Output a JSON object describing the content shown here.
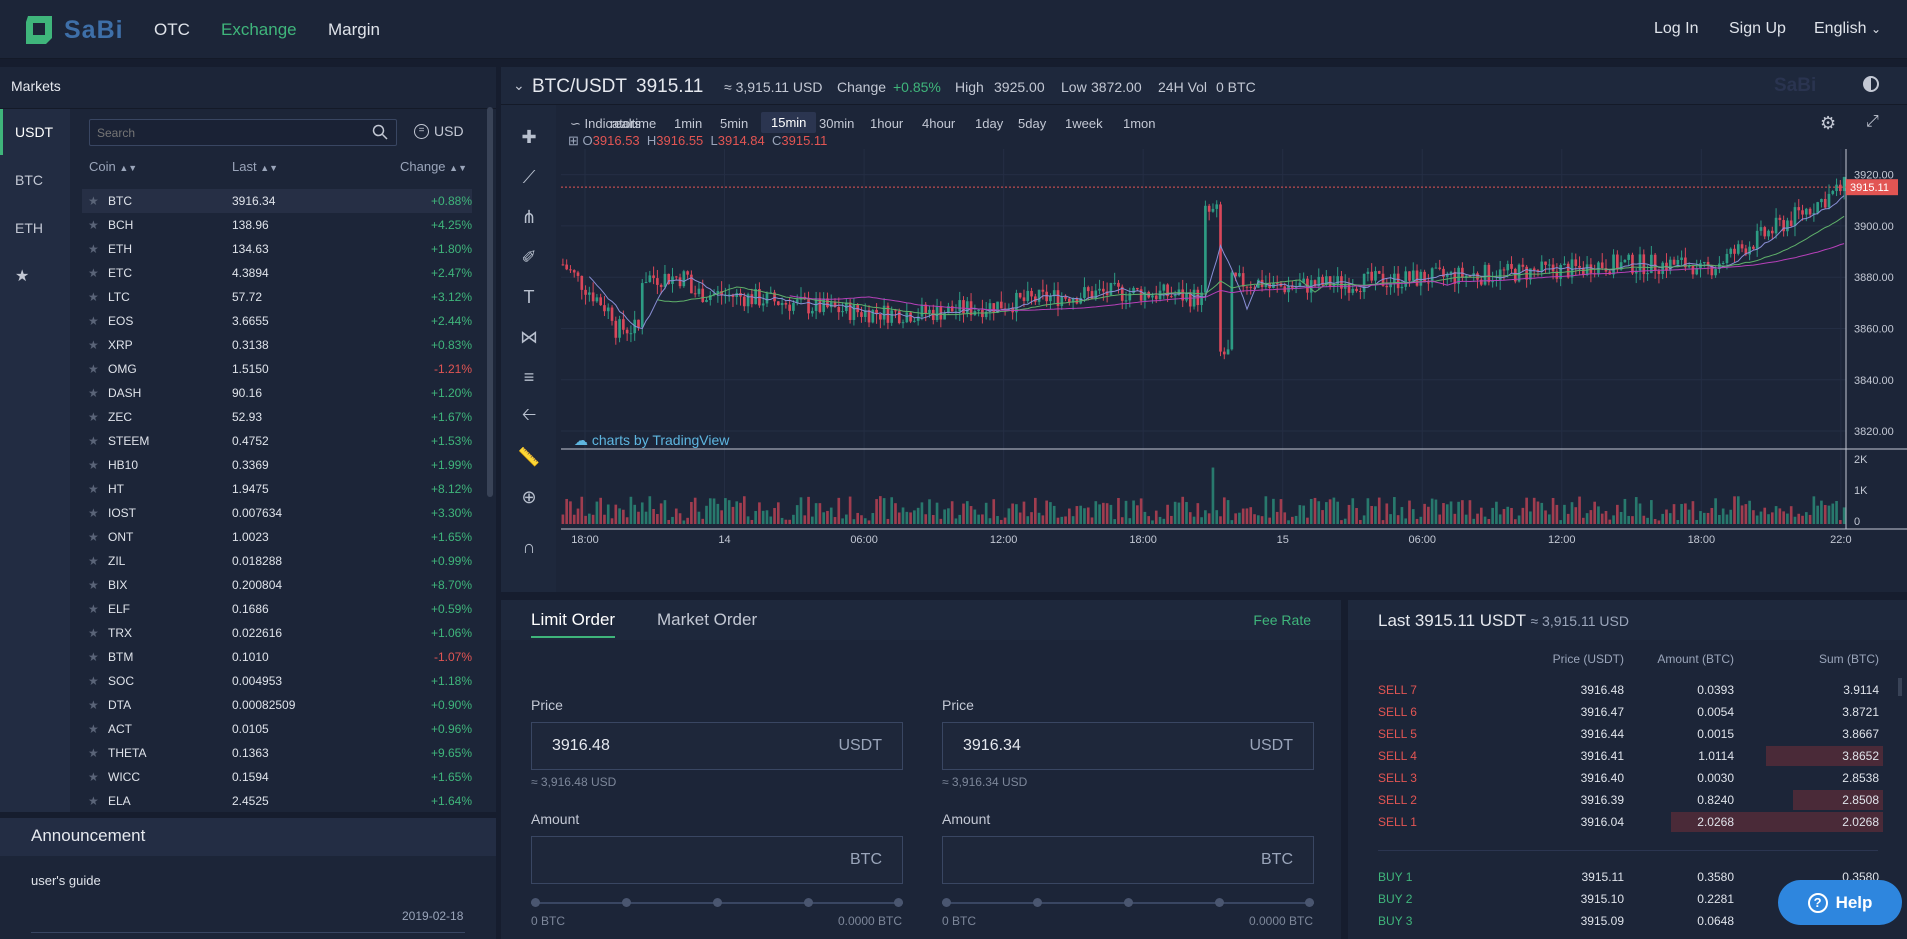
{
  "brand": {
    "name": "SaBi",
    "accent": "#3fb57b"
  },
  "nav": {
    "otc": "OTC",
    "exchange": "Exchange",
    "margin": "Margin"
  },
  "top_right": {
    "login": "Log In",
    "signup": "Sign Up",
    "language": "English"
  },
  "markets": {
    "title": "Markets",
    "quote_tabs": [
      "USDT",
      "BTC",
      "ETH"
    ],
    "favorites_icon": "star-icon",
    "search_placeholder": "Search",
    "currency": "USD",
    "columns": {
      "coin": "Coin",
      "last": "Last",
      "change": "Change"
    },
    "rows": [
      {
        "coin": "BTC",
        "last": "3916.34",
        "change": "+0.88%"
      },
      {
        "coin": "BCH",
        "last": "138.96",
        "change": "+4.25%"
      },
      {
        "coin": "ETH",
        "last": "134.63",
        "change": "+1.80%"
      },
      {
        "coin": "ETC",
        "last": "4.3894",
        "change": "+2.47%"
      },
      {
        "coin": "LTC",
        "last": "57.72",
        "change": "+3.12%"
      },
      {
        "coin": "EOS",
        "last": "3.6655",
        "change": "+2.44%"
      },
      {
        "coin": "XRP",
        "last": "0.3138",
        "change": "+0.83%"
      },
      {
        "coin": "OMG",
        "last": "1.5150",
        "change": "-1.21%"
      },
      {
        "coin": "DASH",
        "last": "90.16",
        "change": "+1.20%"
      },
      {
        "coin": "ZEC",
        "last": "52.93",
        "change": "+1.67%"
      },
      {
        "coin": "STEEM",
        "last": "0.4752",
        "change": "+1.53%"
      },
      {
        "coin": "HB10",
        "last": "0.3369",
        "change": "+1.99%"
      },
      {
        "coin": "HT",
        "last": "1.9475",
        "change": "+8.12%"
      },
      {
        "coin": "IOST",
        "last": "0.007634",
        "change": "+3.30%"
      },
      {
        "coin": "ONT",
        "last": "1.0023",
        "change": "+1.65%"
      },
      {
        "coin": "ZIL",
        "last": "0.018288",
        "change": "+0.99%"
      },
      {
        "coin": "BIX",
        "last": "0.200804",
        "change": "+8.70%"
      },
      {
        "coin": "ELF",
        "last": "0.1686",
        "change": "+0.59%"
      },
      {
        "coin": "TRX",
        "last": "0.022616",
        "change": "+1.06%"
      },
      {
        "coin": "BTM",
        "last": "0.1010",
        "change": "-1.07%"
      },
      {
        "coin": "SOC",
        "last": "0.004953",
        "change": "+1.18%"
      },
      {
        "coin": "DTA",
        "last": "0.00082509",
        "change": "+0.90%"
      },
      {
        "coin": "ACT",
        "last": "0.0105",
        "change": "+0.96%"
      },
      {
        "coin": "THETA",
        "last": "0.1363",
        "change": "+9.65%"
      },
      {
        "coin": "WICC",
        "last": "0.1594",
        "change": "+1.65%"
      },
      {
        "coin": "ELA",
        "last": "2.4525",
        "change": "+1.64%"
      }
    ]
  },
  "announcement": {
    "title": "Announcement",
    "item": "user's guide",
    "date": "2019-02-18"
  },
  "ticker": {
    "pair": "BTC/USDT",
    "price": "3915.11",
    "usd": "≈ 3,915.11 USD",
    "change_label": "Change",
    "change": "+0.85%",
    "high_label": "High",
    "high": "3925.00",
    "low_label": "Low",
    "low": "3872.00",
    "vol_label": "24H Vol",
    "vol": "0 BTC"
  },
  "chart_toolbar": {
    "indicators": "Indicators",
    "timeframes": [
      "realtime",
      "1min",
      "5min",
      "15min",
      "30min",
      "1hour",
      "4hour",
      "1day",
      "5day",
      "1week",
      "1mon"
    ],
    "active": "15min"
  },
  "chart_data": {
    "type": "candlestick",
    "ohlc_labels": {
      "o": "O",
      "h": "H",
      "l": "L",
      "c": "C"
    },
    "ohlc": {
      "o": "3916.53",
      "h": "3916.55",
      "l": "3914.84",
      "c": "3915.11"
    },
    "last_price_tag": "3915.11",
    "watermark": "charts by TradingView",
    "y_ticks": [
      "3920.00",
      "3900.00",
      "3880.00",
      "3860.00",
      "3840.00",
      "3820.00"
    ],
    "ylim": [
      3813,
      3930
    ],
    "volume_ticks": [
      "2K",
      "1K",
      "0"
    ],
    "x_ticks": [
      "18:00",
      "14",
      "06:00",
      "12:00",
      "18:00",
      "15",
      "06:00",
      "12:00",
      "18:00",
      "22:0"
    ],
    "colors": {
      "up": "#2d9c84",
      "down": "#d9475a",
      "ma1": "#8a8fd6",
      "ma2": "#b640b9",
      "ma3": "#5fb06a"
    }
  },
  "order_form": {
    "tabs": [
      "Limit Order",
      "Market Order"
    ],
    "fee_rate": "Fee Rate",
    "buy": {
      "price_label": "Price",
      "price": "3916.48",
      "price_unit": "USDT",
      "price_usd": "≈ 3,916.48 USD",
      "amount_label": "Amount",
      "amount_unit": "BTC",
      "min": "0 BTC",
      "max": "0.0000 BTC"
    },
    "sell": {
      "price_label": "Price",
      "price": "3916.34",
      "price_unit": "USDT",
      "price_usd": "≈ 3,916.34 USD",
      "amount_label": "Amount",
      "amount_unit": "BTC",
      "min": "0 BTC",
      "max": "0.0000 BTC"
    }
  },
  "orderbook": {
    "last_label": "Last 3915.11 USDT",
    "last_usd": "≈ 3,915.11 USD",
    "columns": {
      "price": "Price (USDT)",
      "amount": "Amount (BTC)",
      "sum": "Sum (BTC)"
    },
    "sells": [
      {
        "label": "SELL 7",
        "price": "3916.48",
        "amount": "0.0393",
        "sum": "3.9114",
        "depth": 0
      },
      {
        "label": "SELL 6",
        "price": "3916.47",
        "amount": "0.0054",
        "sum": "3.8721",
        "depth": 0
      },
      {
        "label": "SELL 5",
        "price": "3916.44",
        "amount": "0.0015",
        "sum": "3.8667",
        "depth": 0
      },
      {
        "label": "SELL 4",
        "price": "3916.41",
        "amount": "1.0114",
        "sum": "3.8652",
        "depth": 0.22
      },
      {
        "label": "SELL 3",
        "price": "3916.40",
        "amount": "0.0030",
        "sum": "2.8538",
        "depth": 0
      },
      {
        "label": "SELL 2",
        "price": "3916.39",
        "amount": "0.8240",
        "sum": "2.8508",
        "depth": 0.17
      },
      {
        "label": "SELL 1",
        "price": "3916.04",
        "amount": "2.0268",
        "sum": "2.0268",
        "depth": 0.4
      }
    ],
    "buys": [
      {
        "label": "BUY 1",
        "price": "3915.11",
        "amount": "0.3580",
        "sum": "0.3580"
      },
      {
        "label": "BUY 2",
        "price": "3915.10",
        "amount": "0.2281",
        "sum": "0.5861"
      },
      {
        "label": "BUY 3",
        "price": "3915.09",
        "amount": "0.0648",
        "sum": "0.6509"
      }
    ]
  },
  "help": {
    "label": "Help"
  }
}
